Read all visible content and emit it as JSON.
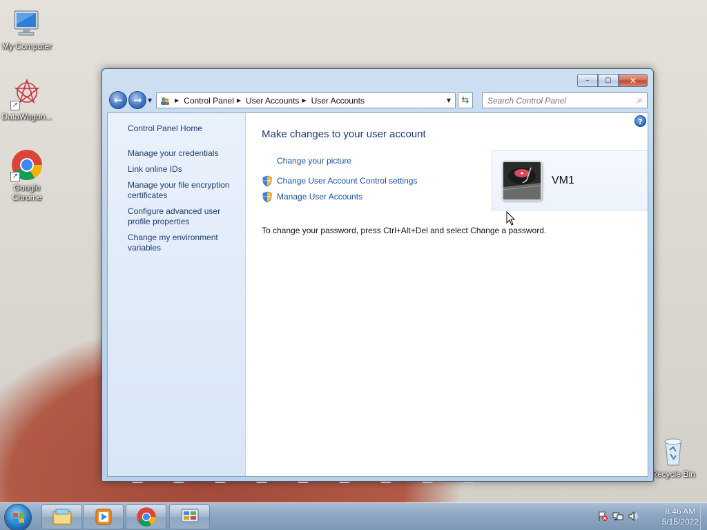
{
  "desktop": {
    "icons": [
      {
        "label": "My Computer"
      },
      {
        "label": "DataWagon..."
      },
      {
        "label": "Google Chrome"
      },
      {
        "label": "Recycle Bin"
      }
    ]
  },
  "window": {
    "caption": {
      "minimize": "–",
      "maximize": "▢",
      "close": "✕"
    },
    "address": {
      "breadcrumbs": [
        "Control Panel",
        "User Accounts",
        "User Accounts"
      ]
    },
    "search": {
      "placeholder": "Search Control Panel"
    },
    "left_pane": {
      "home": "Control Panel Home",
      "links": [
        "Manage your credentials",
        "Link online IDs",
        "Manage your file encryption certificates",
        "Configure advanced user profile properties",
        "Change my environment variables"
      ]
    },
    "main": {
      "title": "Make changes to your user account",
      "tasks": [
        {
          "label": "Change your picture",
          "shield": false
        },
        {
          "label": "Change User Account Control settings",
          "shield": true
        },
        {
          "label": "Manage User Accounts",
          "shield": true
        }
      ],
      "password_note": "To change your password, press Ctrl+Alt+Del and select Change a password.",
      "account": {
        "name": "VM1"
      },
      "help": "?"
    }
  },
  "taskbar": {
    "items": [
      "file-explorer-icon",
      "media-player-icon",
      "chrome-icon",
      "control-panel-icon"
    ],
    "tray_icons": [
      "action-center-icon",
      "network-icon",
      "volume-icon"
    ],
    "clock": {
      "time": "8:46 AM",
      "date": "5/15/2022"
    }
  }
}
